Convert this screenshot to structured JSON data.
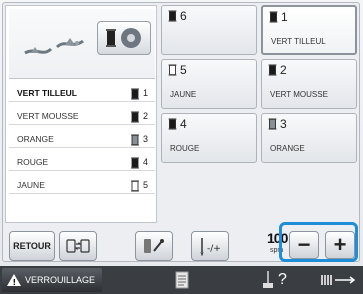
{
  "thread_list": [
    {
      "name": "VERT TILLEUL",
      "num": "1",
      "spool": "filled",
      "selected": true
    },
    {
      "name": "VERT MOUSSE",
      "num": "2",
      "spool": "filled",
      "selected": false
    },
    {
      "name": "ORANGE",
      "num": "3",
      "spool": "gray",
      "selected": false
    },
    {
      "name": "ROUGE",
      "num": "4",
      "spool": "filled",
      "selected": false
    },
    {
      "name": "JAUNE",
      "num": "5",
      "spool": "empty",
      "selected": false
    }
  ],
  "grid": [
    {
      "num": "6",
      "name": "",
      "spool": "filled",
      "selected": false
    },
    {
      "num": "1",
      "name": "VERT TILLEUL",
      "spool": "filled",
      "selected": true
    },
    {
      "num": "5",
      "name": "JAUNE",
      "spool": "empty",
      "selected": false
    },
    {
      "num": "2",
      "name": "VERT MOUSSE",
      "spool": "filled",
      "selected": false
    },
    {
      "num": "4",
      "name": "ROUGE",
      "spool": "filled",
      "selected": false
    },
    {
      "num": "3",
      "name": "ORANGE",
      "spool": "gray",
      "selected": false
    }
  ],
  "buttons": {
    "retour": "RETOUR",
    "speed_value": "100",
    "speed_unit": "spm",
    "minus": "−",
    "plus": "+"
  },
  "bottom_bar": {
    "lock_label": "VERROUILLAGE",
    "help": "?",
    "lock_icon": "warning-icon",
    "page_icon": "page-icon",
    "thread_icon": "needle-icon",
    "extend_icon": "extend-arrow-icon"
  },
  "colors": {
    "highlight": "#1e8ed8"
  }
}
